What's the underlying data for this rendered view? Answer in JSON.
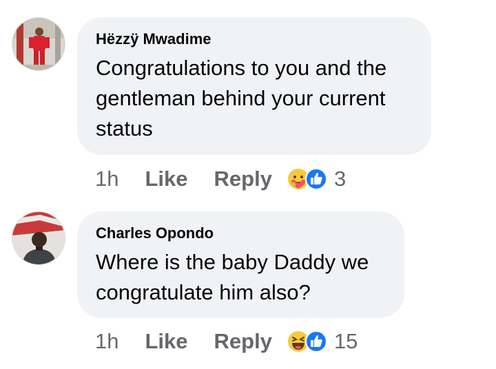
{
  "comments": [
    {
      "author": "Hëzzÿ Mwadime",
      "text": "Congratulations to you and the gentleman behind your current status",
      "time": "1h",
      "like_label": "Like",
      "reply_label": "Reply",
      "reaction_count": "3",
      "reactions": [
        "care-emoji-icon",
        "like-thumb-icon"
      ]
    },
    {
      "author": "Charles Opondo",
      "text": "Where is the baby Daddy we congratulate him also?",
      "time": "1h",
      "like_label": "Like",
      "reply_label": "Reply",
      "reaction_count": "15",
      "reactions": [
        "haha-emoji-icon",
        "like-thumb-icon"
      ]
    }
  ],
  "colors": {
    "bubble_bg": "#f0f2f5",
    "meta_text": "#65676b",
    "like_blue": "#1877f2",
    "emoji_yellow": "#f7c940"
  }
}
